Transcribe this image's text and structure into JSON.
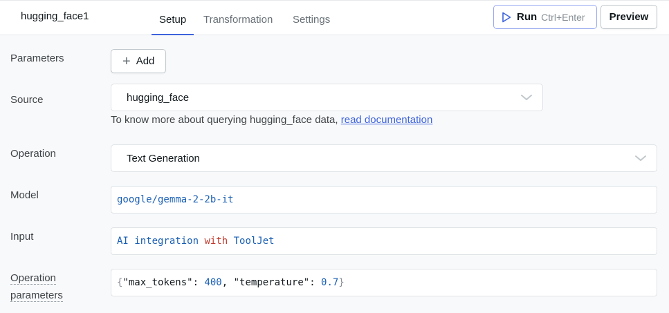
{
  "header": {
    "query_name": "hugging_face1",
    "tabs": [
      {
        "label": "Setup",
        "active": true
      },
      {
        "label": "Transformation",
        "active": false
      },
      {
        "label": "Settings",
        "active": false
      }
    ],
    "run_label": "Run",
    "run_shortcut": "Ctrl+Enter",
    "preview_label": "Preview",
    "accent_color": "#3e63dd"
  },
  "form": {
    "parameters": {
      "label": "Parameters",
      "add_label": "Add",
      "add_icon": "plus-icon"
    },
    "source": {
      "label": "Source",
      "value": "hugging_face",
      "help_text": "To know more about querying hugging_face data,",
      "help_link": "read documentation"
    },
    "operation": {
      "label": "Operation",
      "value": "Text Generation"
    },
    "model": {
      "label": "Model",
      "value": "google/gemma-2-2b-it"
    },
    "input": {
      "label": "Input",
      "value": "AI integration with ToolJet",
      "tokens": [
        "AI integration ",
        "with",
        " ToolJet"
      ]
    },
    "operation_parameters": {
      "label_line1": "Operation",
      "label_line2": "parameters",
      "value": "{\"max_tokens\": 400, \"temperature\": 0.7}",
      "tokens": {
        "open": "{",
        "key1": "\"max_tokens\"",
        "sep1": ": ",
        "val1": "400",
        "comma": ", ",
        "key2": "\"temperature\"",
        "sep2": ": ",
        "val2": "0.7",
        "close": "}"
      }
    }
  }
}
